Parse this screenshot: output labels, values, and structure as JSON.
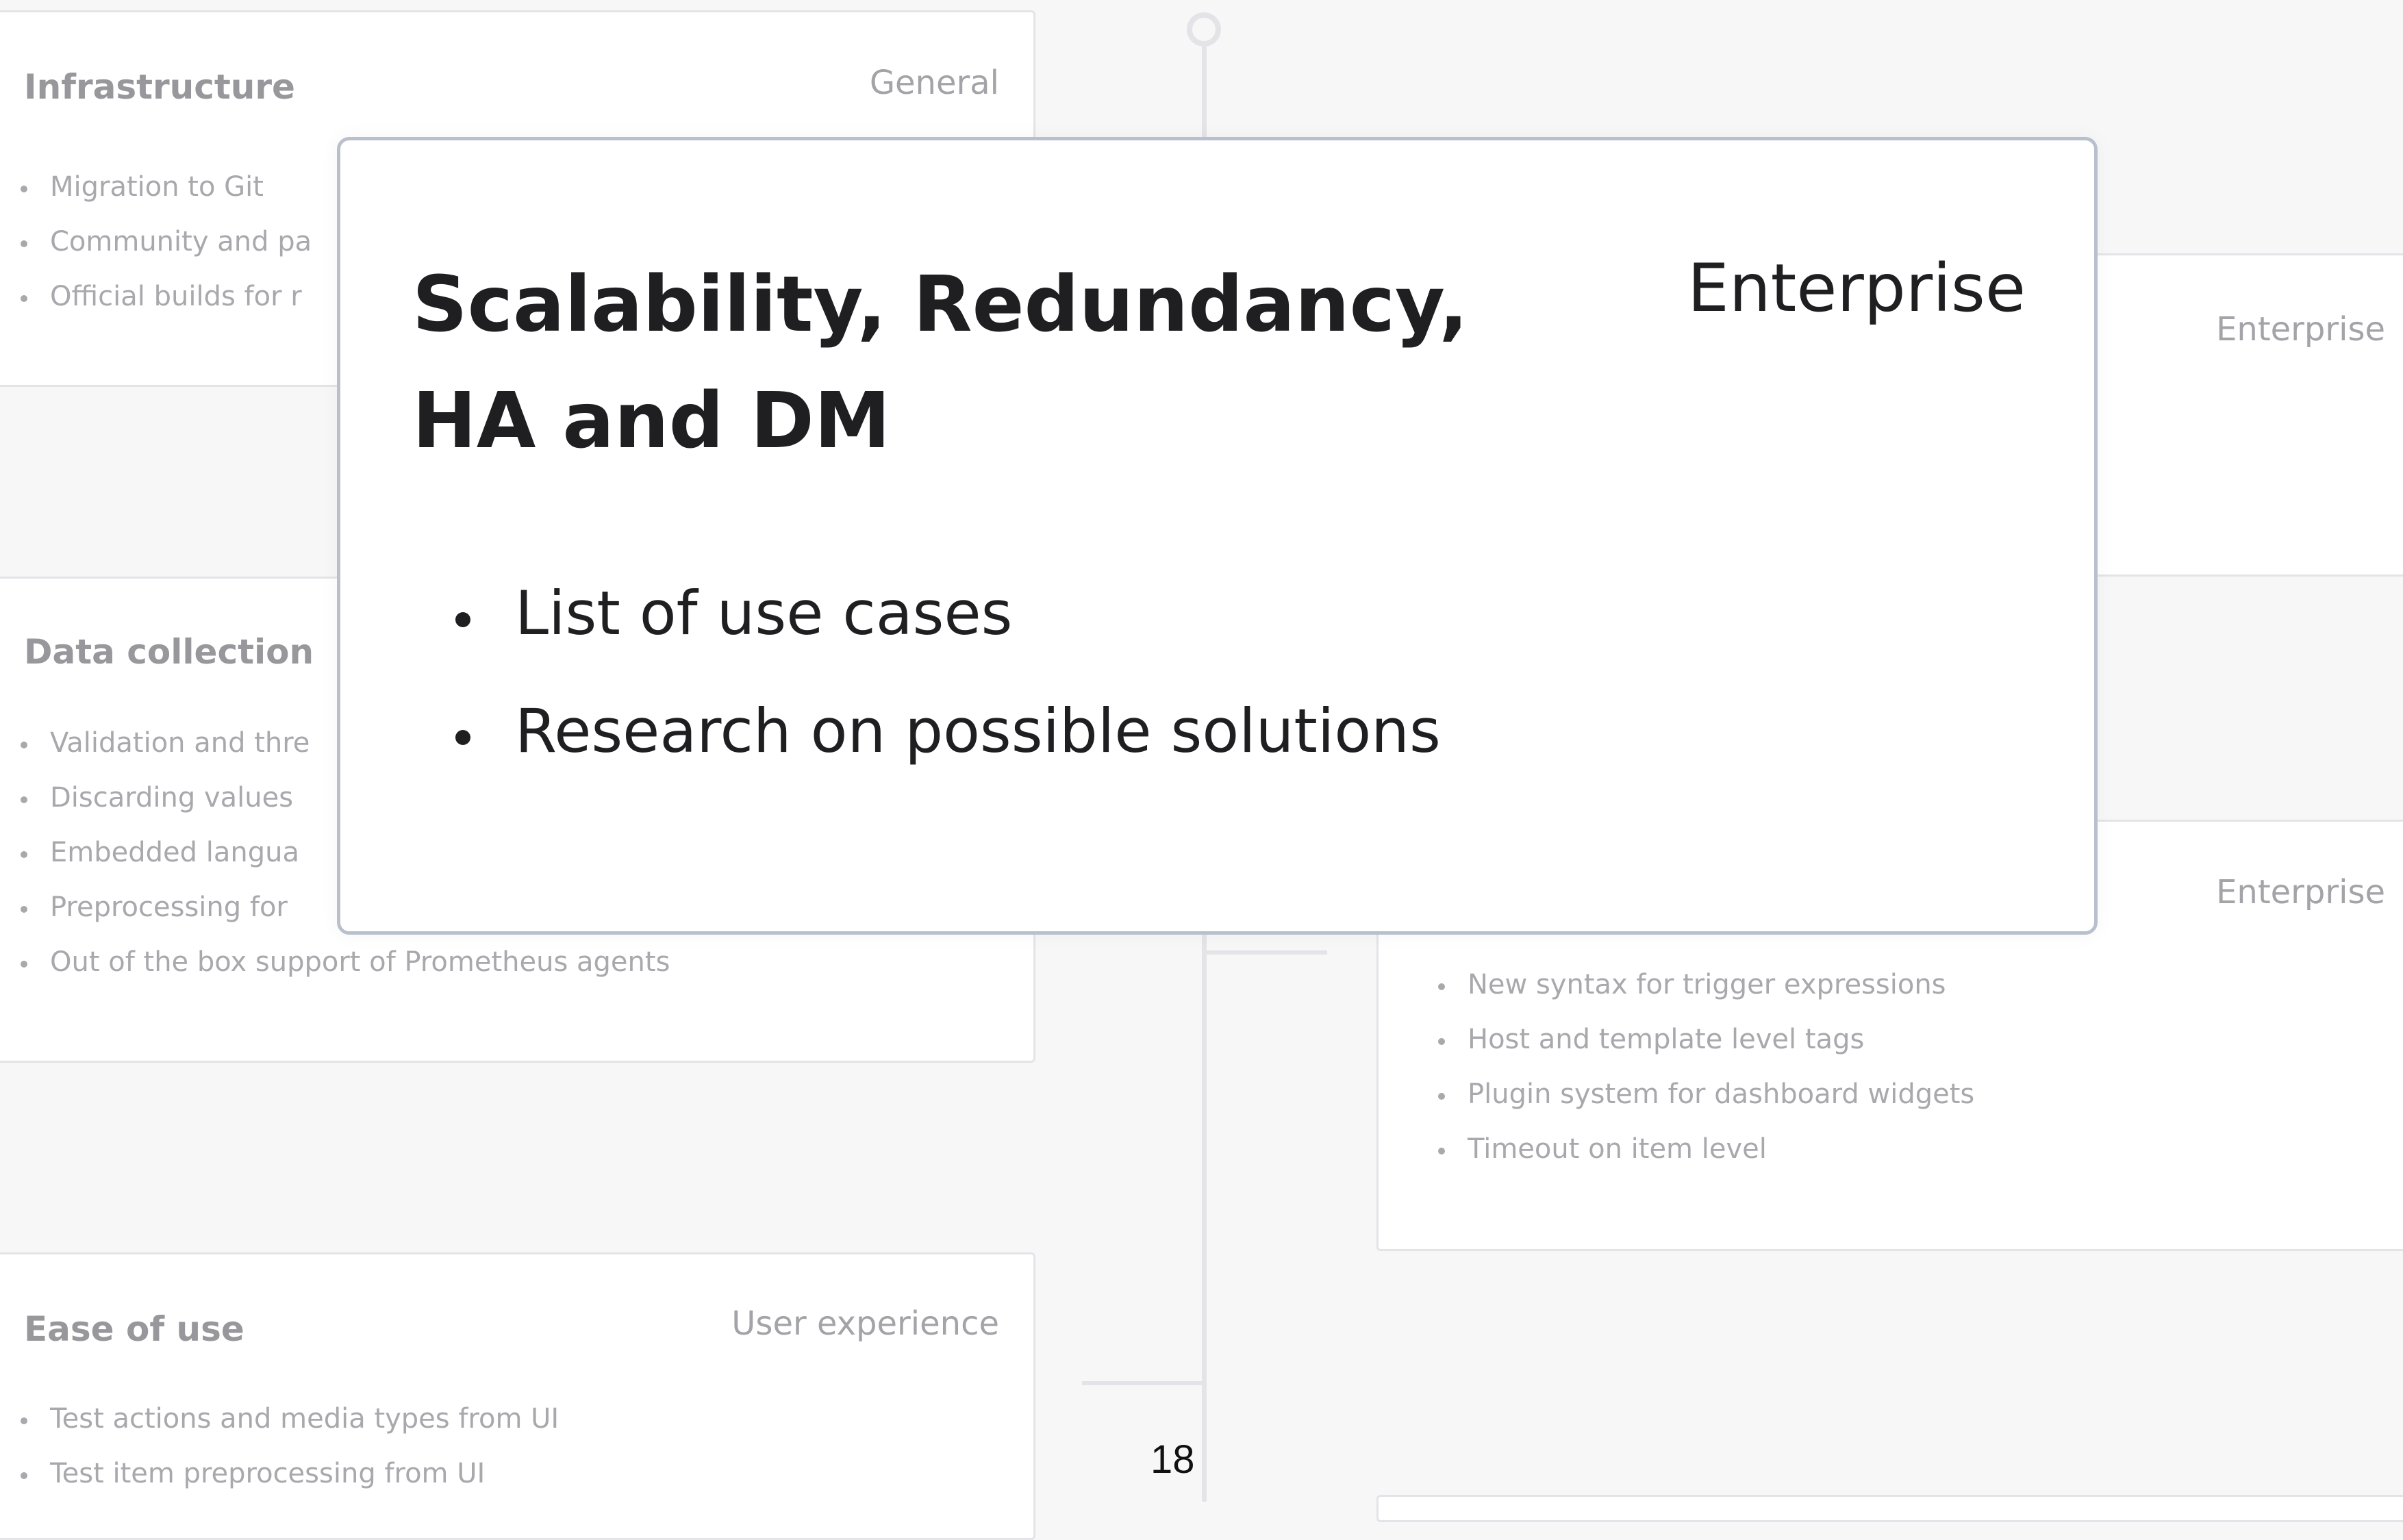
{
  "background_cards": {
    "infrastructure": {
      "title": "Infrastructure",
      "category": "General",
      "items": [
        "Migration to Git",
        "Community and pa",
        "Official builds for r"
      ]
    },
    "data_collection": {
      "title": "Data collection",
      "items": [
        "Validation and thre",
        "Discarding values",
        "Embedded langua",
        "Preprocessing for",
        "Out of the box support of Prometheus agents"
      ]
    },
    "ease_of_use": {
      "title": "Ease of use",
      "category": "User experience",
      "items": [
        "Test actions and media types from UI",
        "Test item preprocessing from UI"
      ]
    },
    "right_top": {
      "category": "Enterprise"
    },
    "right_middle": {
      "category": "Enterprise",
      "items": [
        "New syntax for trigger expressions",
        "Host and template level tags",
        "Plugin system for dashboard widgets",
        "Timeout on item level"
      ]
    }
  },
  "overlay_card": {
    "title": "Scalability, Redundancy, HA and DM",
    "category": "Enterprise",
    "items": [
      "List of use cases",
      "Research on possible solutions"
    ]
  },
  "page_number": "18",
  "colors": {
    "background": "#f7f7f8",
    "card_border": "#e4e4e8",
    "overlay_border": "#b7c0cc",
    "overlay_text": "#1f1f22",
    "muted_text": "#9a9a9e"
  }
}
